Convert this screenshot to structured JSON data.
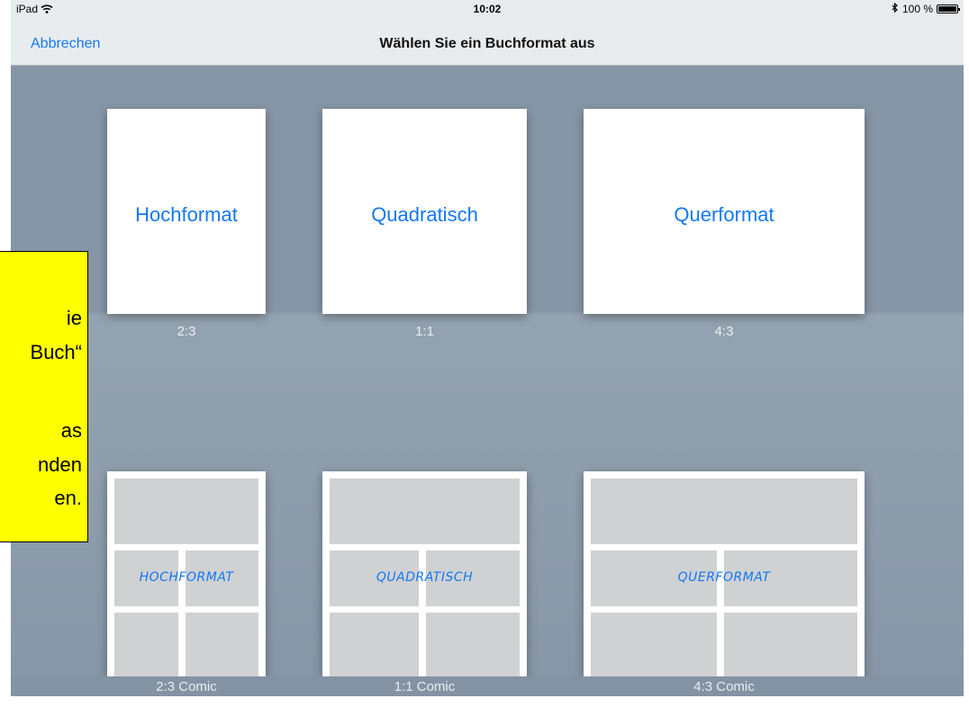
{
  "status": {
    "device": "iPad",
    "time": "10:02",
    "battery": "100 %"
  },
  "nav": {
    "cancel_label": "Abbrechen",
    "title": "Wählen Sie ein Buchformat aus"
  },
  "formats": [
    {
      "label": "Hochformat",
      "ratio": "2:3"
    },
    {
      "label": "Quadratisch",
      "ratio": "1:1"
    },
    {
      "label": "Querformat",
      "ratio": "4:3"
    }
  ],
  "comic_formats": [
    {
      "label": "HOCHFORMAT",
      "ratio": "2:3 Comic"
    },
    {
      "label": "QUADRATISCH",
      "ratio": "1:1 Comic"
    },
    {
      "label": "QUERFORMAT",
      "ratio": "4:3 Comic"
    }
  ],
  "note_lines": [
    "ie",
    "Buch“",
    "as",
    "nden",
    "en."
  ],
  "colors": {
    "accent": "#1478f0",
    "background": "#8a9aab",
    "note": "#ffff00"
  }
}
